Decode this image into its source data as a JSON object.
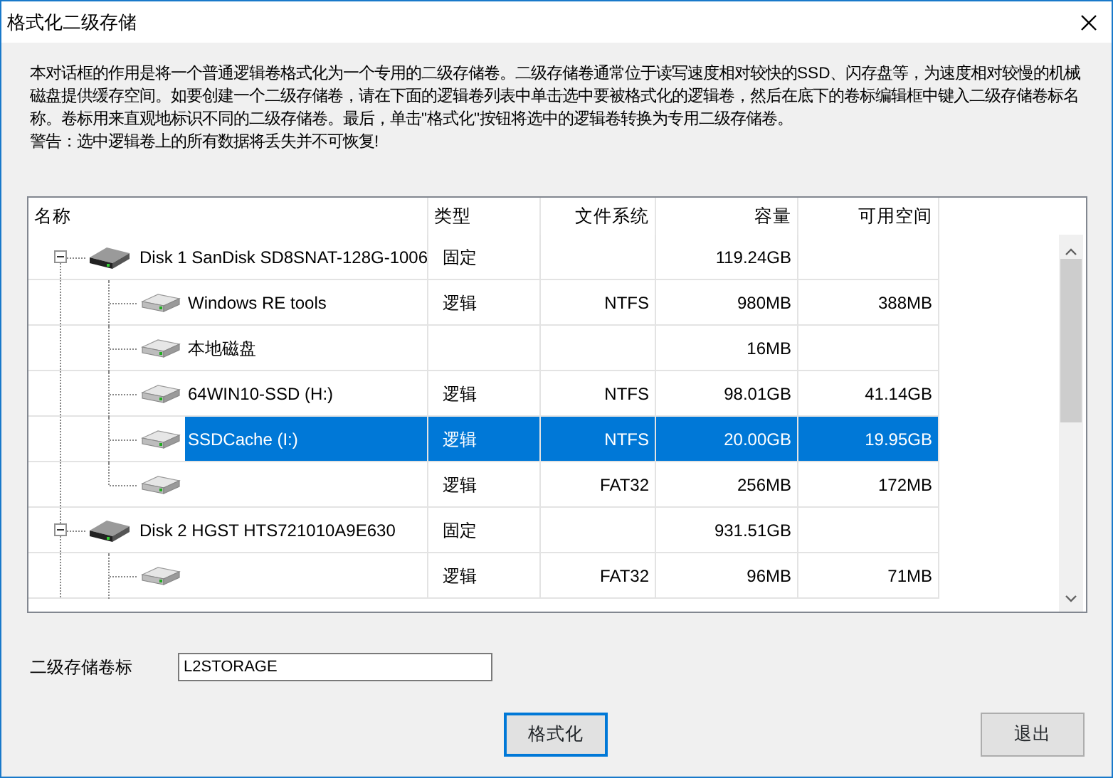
{
  "window": {
    "title": "格式化二级存储"
  },
  "description": "本对话框的作用是将一个普通逻辑卷格式化为一个专用的二级存储卷。二级存储卷通常位于读写速度相对较快的SSD、闪存盘等，为速度相对较慢的机械磁盘提供缓存空间。如要创建一个二级存储卷，请在下面的逻辑卷列表中单击选中要被格式化的逻辑卷，然后在底下的卷标编辑框中键入二级存储卷标名称。卷标用来直观地标识不同的二级存储卷。最后，单击\"格式化\"按钮将选中的逻辑卷转换为专用二级存储卷。",
  "warning": "警告：选中逻辑卷上的所有数据将丢失并不可恢复!",
  "table": {
    "columns": [
      "名称",
      "类型",
      "文件系统",
      "容量",
      "可用空间"
    ],
    "rows": [
      {
        "kind": "disk",
        "name": "Disk 1 SanDisk SD8SNAT-128G-1006",
        "type": "固定",
        "capacity": "119.24GB",
        "expanded": true,
        "selected": false,
        "children": [
          {
            "kind": "volume",
            "name": "Windows RE tools",
            "type": "逻辑",
            "filesystem": "NTFS",
            "capacity": "980MB",
            "free": "388MB",
            "selected": false
          },
          {
            "kind": "volume",
            "name": "本地磁盘",
            "capacity": "16MB",
            "selected": false
          },
          {
            "kind": "volume",
            "name": "64WIN10-SSD (H:)",
            "type": "逻辑",
            "filesystem": "NTFS",
            "capacity": "98.01GB",
            "free": "41.14GB",
            "selected": false
          },
          {
            "kind": "volume",
            "name": "SSDCache (I:)",
            "type": "逻辑",
            "filesystem": "NTFS",
            "capacity": "20.00GB",
            "free": "19.95GB",
            "selected": true
          },
          {
            "kind": "volume",
            "type": "逻辑",
            "filesystem": "FAT32",
            "capacity": "256MB",
            "free": "172MB",
            "selected": false
          }
        ]
      },
      {
        "kind": "disk",
        "name": "Disk 2 HGST HTS721010A9E630",
        "type": "固定",
        "capacity": "931.51GB",
        "expanded": true,
        "selected": false,
        "children": [
          {
            "kind": "volume",
            "type": "逻辑",
            "filesystem": "FAT32",
            "capacity": "96MB",
            "free": "71MB",
            "selected": false
          }
        ]
      }
    ]
  },
  "label_field": {
    "label": "二级存储卷标",
    "value": "L2STORAGE"
  },
  "buttons": [
    {
      "label": "格式化",
      "default": true
    },
    {
      "label": "退出",
      "default": false
    }
  ]
}
